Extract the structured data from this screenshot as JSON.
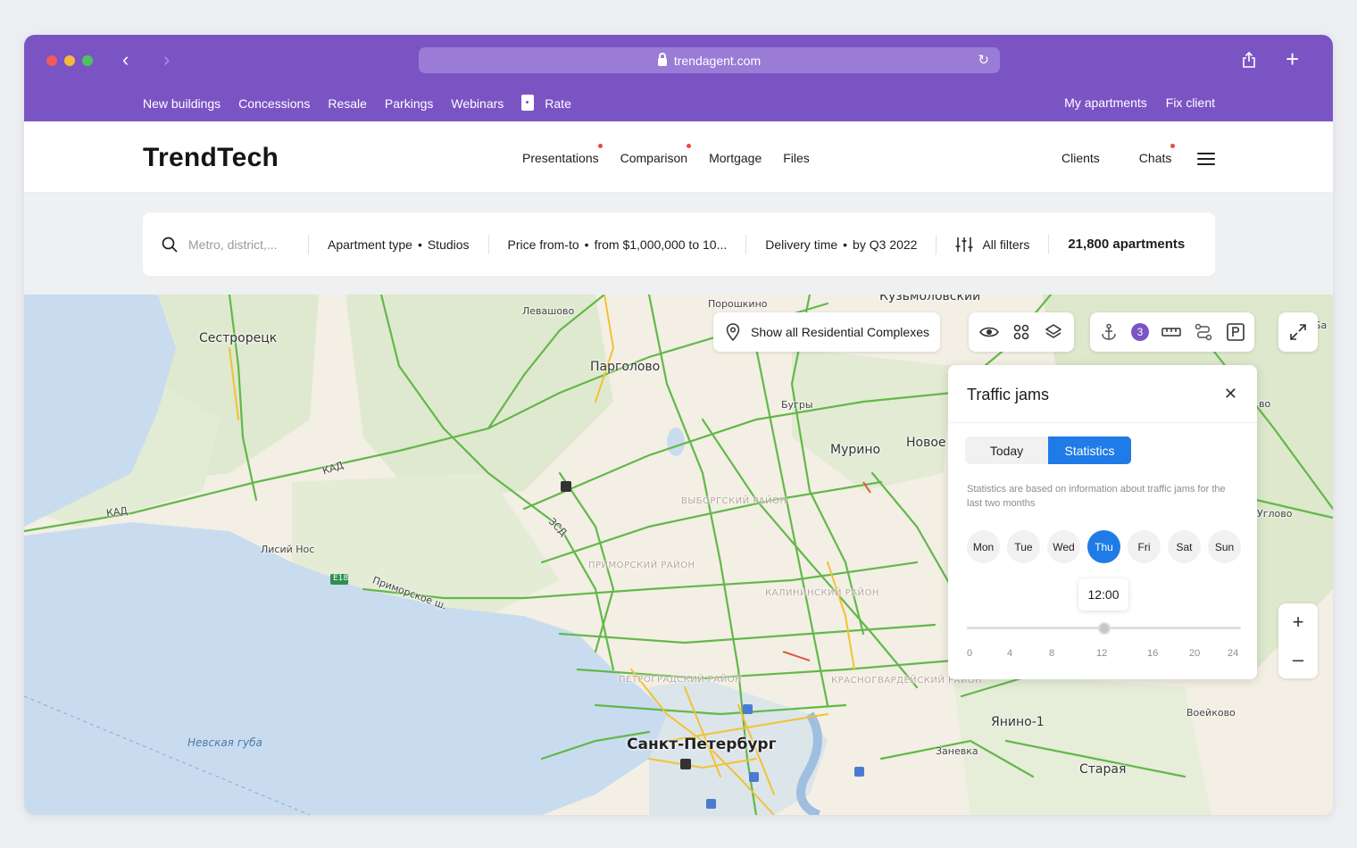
{
  "browser": {
    "url": "trendagent.com"
  },
  "subnav": {
    "left": [
      "New buildings",
      "Concessions",
      "Resale",
      "Parkings",
      "Webinars"
    ],
    "rate": "Rate",
    "right": [
      "My apartments",
      "Fix client"
    ]
  },
  "header": {
    "logo": "TrendTech",
    "nav": [
      "Presentations",
      "Comparison",
      "Mortgage",
      "Files"
    ],
    "clients": "Clients",
    "chats": "Chats"
  },
  "filters": {
    "search_placeholder": "Metro, district,...",
    "apartment_label": "Apartment type",
    "apartment_value": "Studios",
    "price_label": "Price from-to",
    "price_value": "from $1,000,000 to 10...",
    "delivery_label": "Delivery time",
    "delivery_value": "by Q3 2022",
    "all_filters": "All filters",
    "count": "21,800 apartments"
  },
  "map": {
    "show_all": "Show all Residential Complexes",
    "badge": "3",
    "labels": {
      "sestroretsk": "Сестрорецк",
      "levashovo": "Левашово",
      "poroshkino": "Порошкино",
      "kuzmolovsky": "Кузьмоловский",
      "pargolovo": "Парголово",
      "bugry": "Бугры",
      "murino": "Мурино",
      "novoe": "Новое",
      "lisiy_nos": "Лисий Нос",
      "spb": "Санкт-Петербург",
      "nevskaya": "Невская губа",
      "yanino": "Янино-1",
      "zanevka": "Заневка",
      "staraya": "Старая",
      "voeykovo": "Воейково",
      "vyborgsky": "ВЫБОРГСКИЙ РАЙОН",
      "primorsky": "ПРИМОРСКИЙ РАЙОН",
      "kalininsky": "КАЛИНИНСКИЙ РАЙОН",
      "petrogradsky": "ПЕТРОГРАДСКИЙ РАЙОН",
      "krasnogvardeysky": "КРАСНОГВАРДЕЙСКИЙ РАЙОН",
      "kad": "КАД",
      "zsd": "ЗСД",
      "e18": "E18",
      "primorskoe": "Приморское ш.",
      "gleghlovo": "Углово",
      "ba": "Ба",
      "vo": "во"
    }
  },
  "traffic_panel": {
    "title": "Traffic jams",
    "tab_today": "Today",
    "tab_stats": "Statistics",
    "note": "Statistics are based on information about traffic jams for the last two months",
    "days": [
      "Mon",
      "Tue",
      "Wed",
      "Thu",
      "Fri",
      "Sat",
      "Sun"
    ],
    "selected_day": "Thu",
    "time": "12:00",
    "ticks": [
      "0",
      "4",
      "8",
      "12",
      "16",
      "20",
      "24"
    ],
    "slider_hours": 12
  }
}
